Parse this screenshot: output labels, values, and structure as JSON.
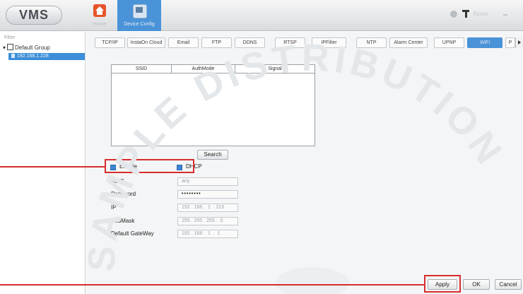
{
  "app": {
    "logo": "VMS",
    "username": "Xxxxx"
  },
  "nav": [
    {
      "label": "Home",
      "icon": "home-icon"
    },
    {
      "label": "Device Config",
      "icon": "device-config-icon"
    }
  ],
  "sidebar": {
    "filter_label": "Filter",
    "group_label": "Default Group",
    "device_label": "192.168.1.228"
  },
  "tabs": [
    {
      "label": "TCP/IP"
    },
    {
      "label": "InstaOn Cloud"
    },
    {
      "label": "Email"
    },
    {
      "label": "FTP"
    },
    {
      "label": "DDNS"
    },
    {
      "label": "RTSP"
    },
    {
      "label": "IPFilter"
    },
    {
      "label": "NTP"
    },
    {
      "label": "Alarm Center"
    },
    {
      "label": "UPNP"
    },
    {
      "label": "WiFi",
      "active": true
    },
    {
      "label": "P"
    }
  ],
  "wifi_table": {
    "columns": [
      "SSID",
      "AuthMode",
      "Signal"
    ],
    "rows": []
  },
  "search_label": "Search",
  "checkboxes": {
    "enable_label": "Enable",
    "dhcp_label": "DHCP"
  },
  "form": {
    "ssid_label": "SSID",
    "ssid_placeholder": "any",
    "password_label": "Password",
    "password_value": "••••••••",
    "ip_label": "IP",
    "ip_value": "192 . 168 .  1  . 215",
    "submask_label": "SubMask",
    "submask_value": "255 . 255 . 255 .  0",
    "gateway_label": "Default GateWay",
    "gateway_value": "192 . 168 .  1  .  1"
  },
  "buttons": {
    "apply": "Apply",
    "ok": "OK",
    "cancel": "Cancel"
  },
  "watermark": "SAMPLE DISTRIBUTION",
  "colors": {
    "accent": "#4a93d8",
    "highlight": "#d72d2d",
    "home_icon": "#e8542a"
  }
}
